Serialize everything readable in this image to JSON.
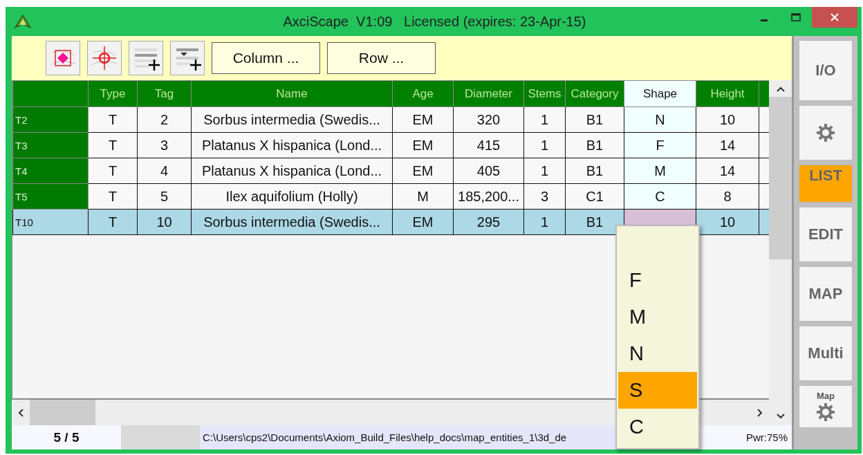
{
  "window": {
    "title": "AxciScape  V1:09   Licensed (expires: 23-Apr-15)"
  },
  "toolbar": {
    "buttons": [
      "Column ...",
      "Row ..."
    ]
  },
  "table": {
    "columns": [
      {
        "label": "Type",
        "selected": false
      },
      {
        "label": "Tag",
        "selected": false
      },
      {
        "label": "Name",
        "selected": false
      },
      {
        "label": "Age",
        "selected": false
      },
      {
        "label": "Diameter",
        "selected": false
      },
      {
        "label": "Stems",
        "selected": false
      },
      {
        "label": "Category",
        "selected": false
      },
      {
        "label": "Shape",
        "selected": true
      },
      {
        "label": "Height",
        "selected": false
      }
    ],
    "rows": [
      {
        "header": "T2",
        "cells": [
          "T",
          "2",
          "Sorbus intermedia (Swedis...",
          "EM",
          "320",
          "1",
          "B1",
          "N",
          "10"
        ],
        "selected": false
      },
      {
        "header": "T3",
        "cells": [
          "T",
          "3",
          "Platanus X hispanica (Lond...",
          "EM",
          "415",
          "1",
          "B1",
          "F",
          "14"
        ],
        "selected": false
      },
      {
        "header": "T4",
        "cells": [
          "T",
          "4",
          "Platanus X hispanica (Lond...",
          "EM",
          "405",
          "1",
          "B1",
          "M",
          "14"
        ],
        "selected": false
      },
      {
        "header": "T5",
        "cells": [
          "T",
          "5",
          "Ilex aquifolium (Holly)",
          "M",
          "185,200...",
          "3",
          "C1",
          "C",
          "8"
        ],
        "selected": false
      },
      {
        "header": "T10",
        "cells": [
          "T",
          "10",
          "Sorbus intermedia (Swedis...",
          "EM",
          "295",
          "1",
          "B1",
          null,
          "10"
        ],
        "selected": true
      }
    ]
  },
  "dropdown": {
    "options": [
      {
        "label": "F",
        "selected": false
      },
      {
        "label": "M",
        "selected": false
      },
      {
        "label": "N",
        "selected": false
      },
      {
        "label": "S",
        "selected": true
      },
      {
        "label": "C",
        "selected": false
      }
    ]
  },
  "status_bar": {
    "count": "5 / 5",
    "path": "C:\\Users\\cps2\\Documents\\Axiom_Build_Files\\help_docs\\map_entities_1\\3d_de",
    "power": "Pwr:75%"
  },
  "side_panel": {
    "buttons": [
      {
        "kind": "text",
        "label": "I/O",
        "selected": false
      },
      {
        "kind": "gear",
        "selected": false
      },
      {
        "kind": "text",
        "label": "LIST",
        "selected": true
      },
      {
        "kind": "text",
        "label": "EDIT",
        "selected": false
      },
      {
        "kind": "text",
        "label": "MAP",
        "selected": false
      },
      {
        "kind": "text",
        "label": "Multi",
        "selected": false
      },
      {
        "kind": "gear",
        "label": "Map",
        "selected": false
      }
    ]
  }
}
